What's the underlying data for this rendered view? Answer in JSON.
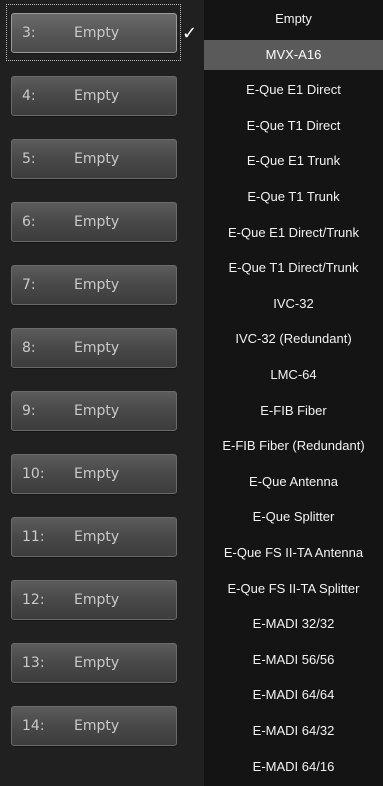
{
  "slots": [
    {
      "number": "3:",
      "value": "Empty",
      "selected": true
    },
    {
      "number": "4:",
      "value": "Empty"
    },
    {
      "number": "5:",
      "value": "Empty"
    },
    {
      "number": "6:",
      "value": "Empty"
    },
    {
      "number": "7:",
      "value": "Empty"
    },
    {
      "number": "8:",
      "value": "Empty"
    },
    {
      "number": "9:",
      "value": "Empty"
    },
    {
      "number": "10:",
      "value": "Empty"
    },
    {
      "number": "11:",
      "value": "Empty"
    },
    {
      "number": "12:",
      "value": "Empty"
    },
    {
      "number": "13:",
      "value": "Empty"
    },
    {
      "number": "14:",
      "value": "Empty"
    }
  ],
  "checkmark": "✓",
  "dropdown": {
    "options": [
      "Empty",
      "MVX-A16",
      "E-Que E1 Direct",
      "E-Que T1 Direct",
      "E-Que E1 Trunk",
      "E-Que T1 Trunk",
      "E-Que E1 Direct/Trunk",
      "E-Que T1 Direct/Trunk",
      "IVC-32",
      "IVC-32 (Redundant)",
      "LMC-64",
      "E-FIB Fiber",
      "E-FIB Fiber (Redundant)",
      "E-Que Antenna",
      "E-Que Splitter",
      "E-Que FS II-TA Antenna",
      "E-Que FS II-TA Splitter",
      "E-MADI 32/32",
      "E-MADI 56/56",
      "E-MADI 64/64",
      "E-MADI 64/32",
      "E-MADI 64/16"
    ],
    "highlighted": "MVX-A16"
  },
  "colors": {
    "highlight": "#5a5a5a",
    "dropdown_bg": "#141414",
    "slot_text": "#c9c9c9"
  }
}
